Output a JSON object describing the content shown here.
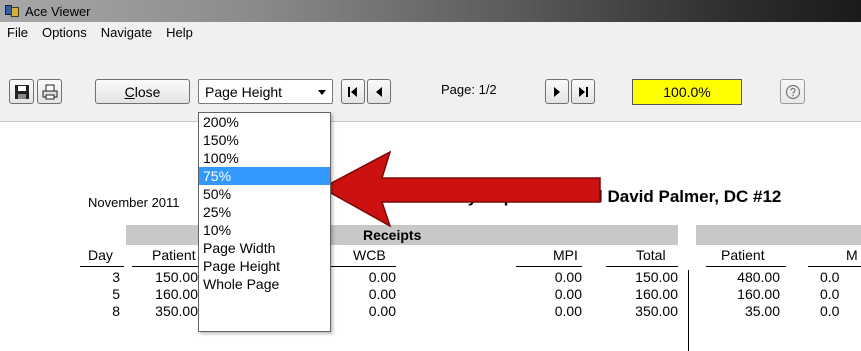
{
  "window": {
    "title": "Ace Viewer"
  },
  "menu": [
    "File",
    "Options",
    "Navigate",
    "Help"
  ],
  "toolbar": {
    "close_label_underlined": "C",
    "close_label_rest": "lose",
    "zoom_selected": "Page Height",
    "page_label": "Page: 1/2",
    "zoom_value": "100.0%",
    "zoom_box_color": "#ffff00"
  },
  "dropdown": {
    "options": [
      "200%",
      "150%",
      "100%",
      "75%",
      "50%",
      "25%",
      "10%",
      "Page Width",
      "Page Height",
      "Whole Page"
    ],
    "highlighted_index": 3,
    "highlight_color": "#3399ff"
  },
  "annotation": {
    "arrow_color": "#cc1111"
  },
  "report": {
    "date": "November 2011",
    "title": "Monthly Report - Daniel David Palmer, DC #12",
    "section": "Receipts",
    "columns": {
      "day": "Day",
      "patient": "Patient",
      "wcb": "WCB",
      "mpi": "MPI",
      "total": "Total",
      "patient2": "Patient",
      "m2": "M"
    },
    "rows": [
      {
        "day": "3",
        "patient": "150.00",
        "wcb": "0.00",
        "mpi": "0.00",
        "total": "150.00",
        "patient2": "480.00",
        "m2": "0.0"
      },
      {
        "day": "5",
        "patient": "160.00",
        "wcb": "0.00",
        "mpi": "0.00",
        "total": "160.00",
        "patient2": "160.00",
        "m2": "0.0"
      },
      {
        "day": "8",
        "patient": "350.00",
        "wcb": "0.00",
        "mpi": "0.00",
        "total": "350.00",
        "patient2": "35.00",
        "m2": "0.0"
      }
    ]
  }
}
